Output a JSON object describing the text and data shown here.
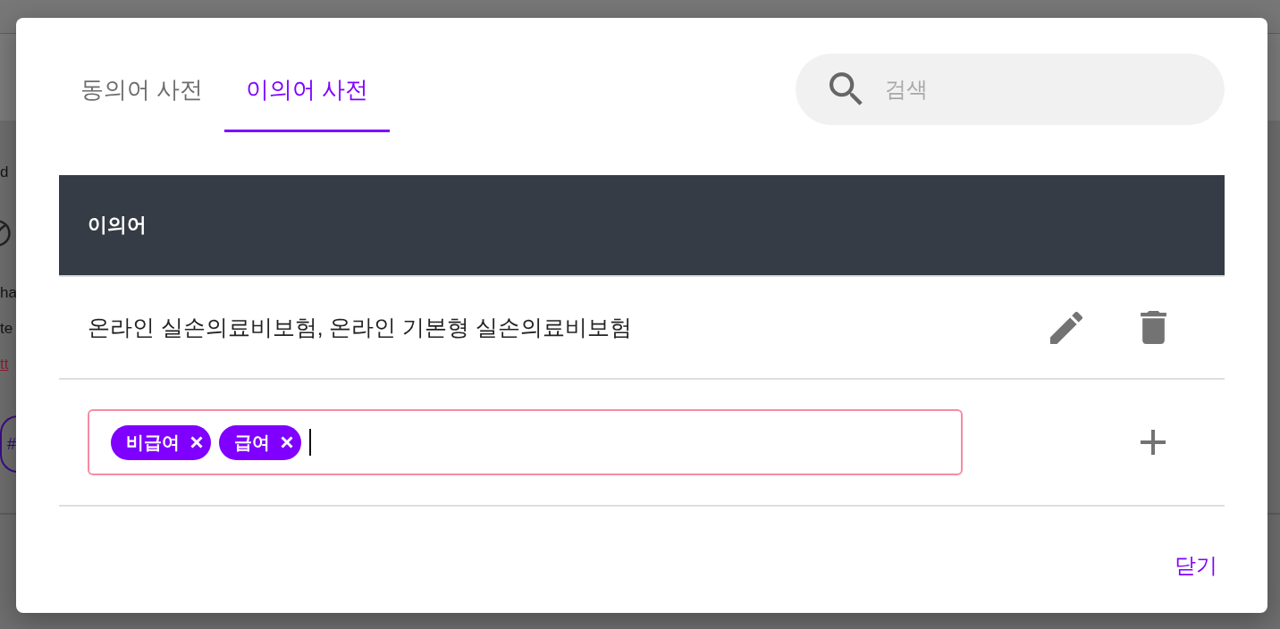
{
  "backdrop": {
    "fragments": [
      {
        "kind": "text",
        "text": "d"
      },
      {
        "kind": "text",
        "text": "ha"
      },
      {
        "kind": "text",
        "text": "te"
      },
      {
        "kind": "link",
        "text": "tt"
      },
      {
        "kind": "tag",
        "text": "#"
      }
    ]
  },
  "dialog": {
    "tabs": [
      {
        "label": "동의어 사전",
        "selected": false
      },
      {
        "label": "이의어 사전",
        "selected": true
      }
    ],
    "search": {
      "placeholder": "검색"
    },
    "table": {
      "columns": [
        "이의어"
      ],
      "rows": [
        {
          "text": "온라인 실손의료비보험, 온라인 기본형 실손의료비보험"
        }
      ]
    },
    "new_entry": {
      "tags": [
        "비급여",
        "급여"
      ]
    },
    "close_button": "닫기"
  }
}
